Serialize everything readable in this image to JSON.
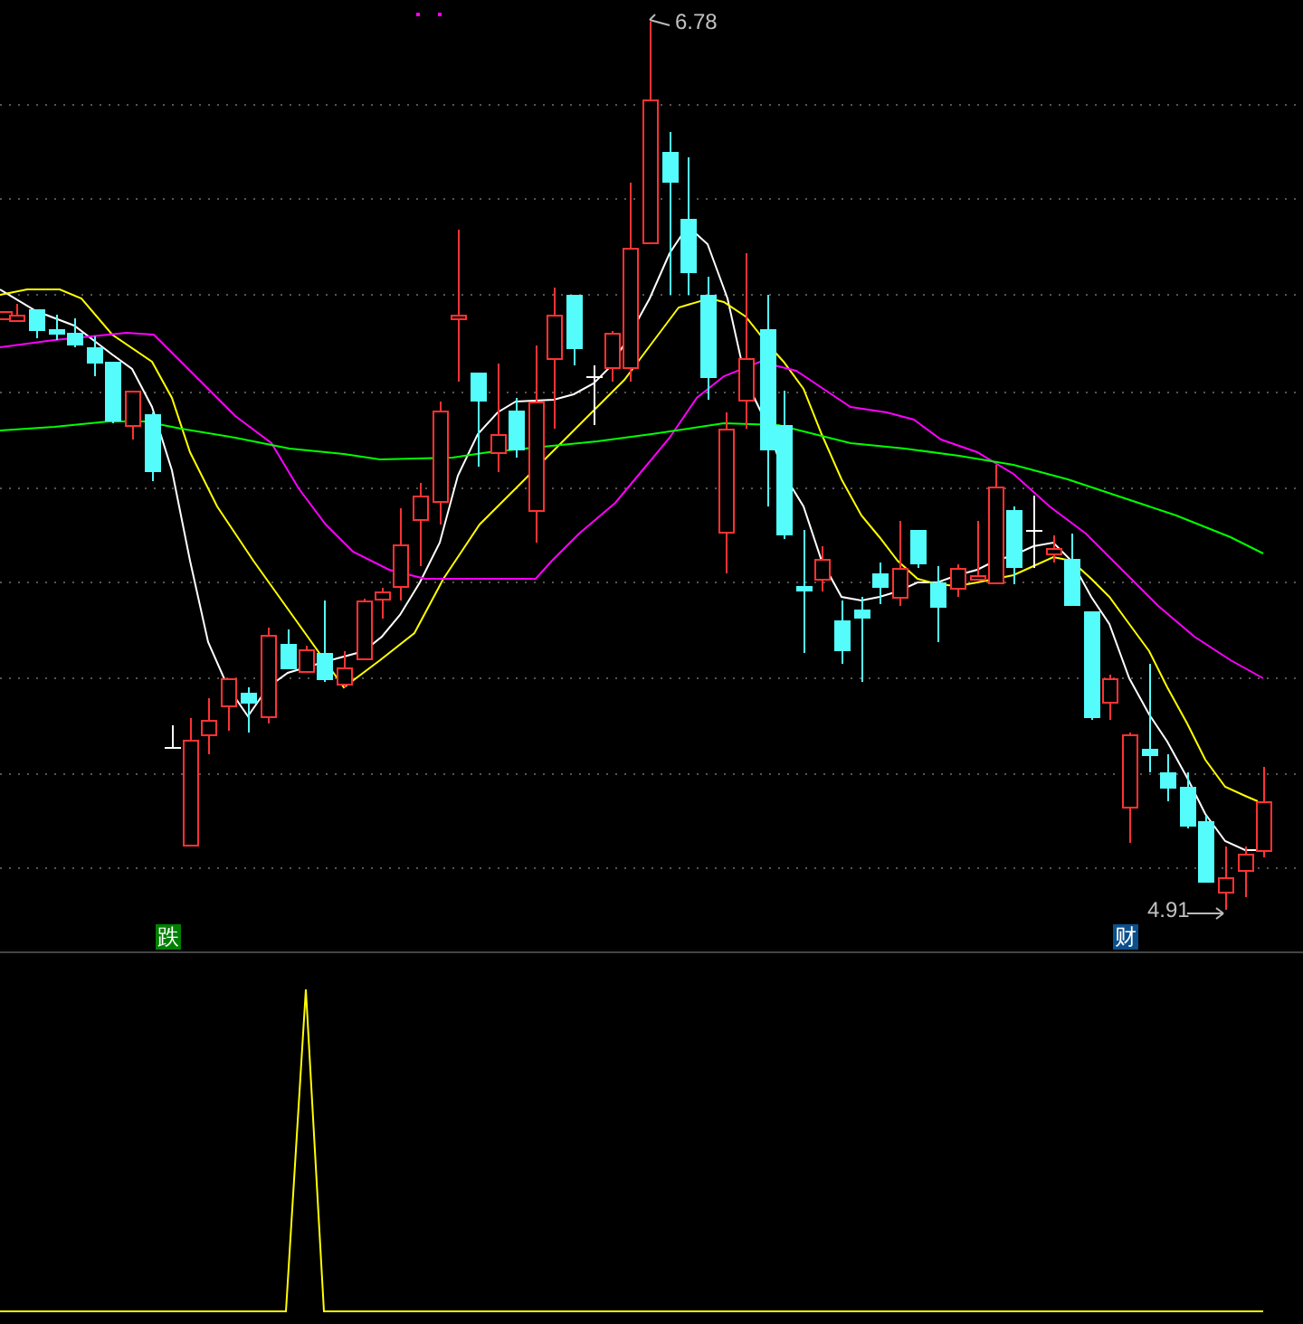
{
  "price_labels": [
    {
      "kind": "high",
      "text": "6.78"
    },
    {
      "kind": "low",
      "text": "4.91"
    }
  ],
  "signals": [
    {
      "text": "跌",
      "color": "#008000"
    },
    {
      "text": "财",
      "color": "#0b4f8c"
    }
  ]
}
